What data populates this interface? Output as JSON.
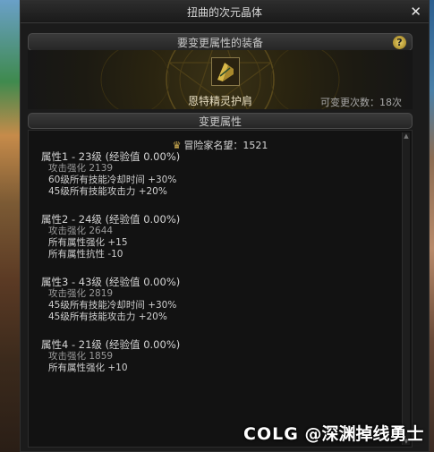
{
  "window": {
    "title": "扭曲的次元晶体",
    "close_symbol": "✕"
  },
  "equip_section": {
    "title": "要变更属性的装备",
    "help_symbol": "?"
  },
  "item": {
    "name": "恩特精灵护肩",
    "change_count": "可变更次数：18次"
  },
  "attr_section": {
    "title": "变更属性"
  },
  "fame": {
    "label": "冒险家名望：1521"
  },
  "attributes": [
    {
      "title": "属性1 - 23级 (经验值 0.00%)",
      "lines": [
        "攻击强化 2139",
        "60级所有技能冷却时间 +30%",
        "45级所有技能攻击力 +20%"
      ]
    },
    {
      "title": "属性2 - 24级 (经验值 0.00%)",
      "lines": [
        "攻击强化 2644",
        "所有属性强化 +15",
        "所有属性抗性 -10"
      ]
    },
    {
      "title": "属性3 - 43级 (经验值 0.00%)",
      "lines": [
        "攻击强化 2819",
        "45级所有技能冷却时间 +30%",
        "45级所有技能攻击力 +20%"
      ]
    },
    {
      "title": "属性4 - 21级 (经验值 0.00%)",
      "lines": [
        "攻击强化 1859",
        "所有属性强化 +10"
      ]
    }
  ],
  "watermark": {
    "logo": "COLG",
    "text": "@深渊掉线勇士"
  }
}
